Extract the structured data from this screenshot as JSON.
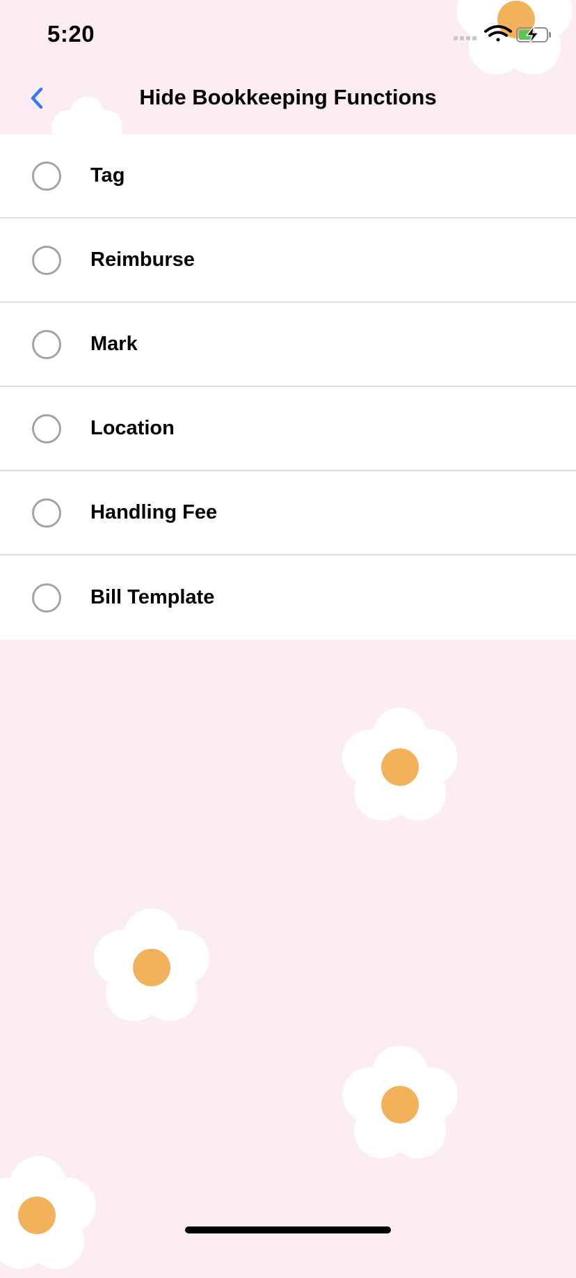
{
  "status_bar": {
    "time": "5:20",
    "icons": [
      "cellular-signal-icon",
      "wifi-icon",
      "battery-charging-icon"
    ]
  },
  "nav": {
    "back_icon": "chevron-left-icon",
    "title": "Hide Bookkeeping Functions"
  },
  "options": [
    {
      "label": "Tag",
      "selected": false
    },
    {
      "label": "Reimburse",
      "selected": false
    },
    {
      "label": "Mark",
      "selected": false
    },
    {
      "label": "Location",
      "selected": false
    },
    {
      "label": "Handling Fee",
      "selected": false
    },
    {
      "label": "Bill Template",
      "selected": false
    }
  ],
  "colors": {
    "background": "#fcedf4",
    "accent": "#3478f6",
    "flower_center": "#f2b25c",
    "radio_border": "#a3a3a3"
  }
}
